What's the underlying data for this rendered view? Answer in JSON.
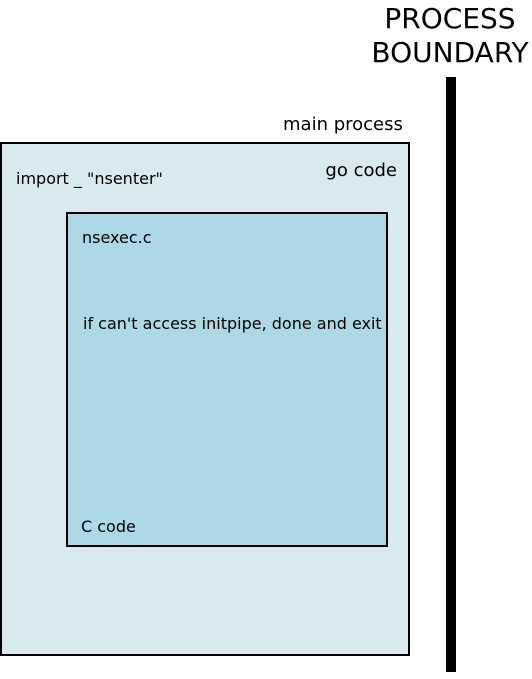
{
  "boundary": {
    "title_line1": "PROCESS",
    "title_line2": "BOUNDARY",
    "line_color": "#000000"
  },
  "main_process": {
    "label": "main process",
    "fill_color": "#d8eaf0",
    "go_code_label": "go code",
    "import_text": "import _ \"nsenter\""
  },
  "nsexec_box": {
    "label": "nsexec.c",
    "fill_color": "#add8e6",
    "description": "if can't access initpipe, done and exit",
    "c_code_label": "C code"
  }
}
